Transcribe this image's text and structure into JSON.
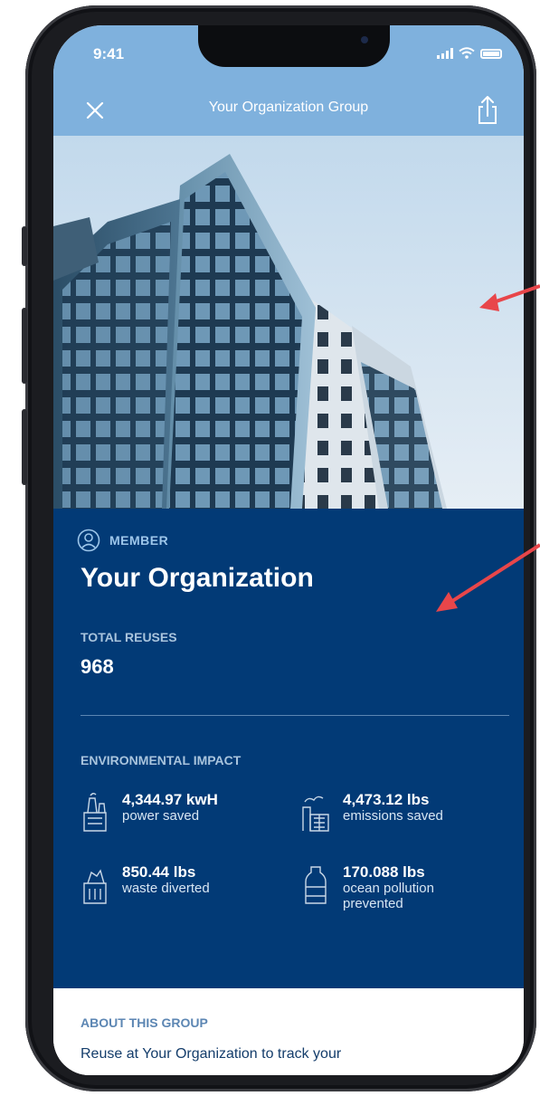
{
  "status_bar": {
    "time": "9:41"
  },
  "header": {
    "title": "Your Organization Group",
    "close_icon": "close-icon",
    "share_icon": "share-icon"
  },
  "hero": {
    "image": "building-photo"
  },
  "organization": {
    "role_label": "MEMBER",
    "role_icon": "user-circle-icon",
    "name": "Your Organization",
    "total_reuses_label": "TOTAL REUSES",
    "total_reuses_value": "968"
  },
  "environmental_impact": {
    "label": "ENVIRONMENTAL IMPACT",
    "stats": [
      {
        "value": "4,344.97 kwH",
        "desc": "power saved",
        "icon": "power-plant-icon"
      },
      {
        "value": "4,473.12 lbs",
        "desc": "emissions saved",
        "icon": "factory-icon"
      },
      {
        "value": "850.44 lbs",
        "desc": "waste diverted",
        "icon": "waste-bin-icon"
      },
      {
        "value": "170.088 lbs",
        "desc_line1": "ocean pollution",
        "desc_line2": "prevented",
        "icon": "bottle-icon"
      }
    ]
  },
  "about": {
    "title": "ABOUT THIS GROUP",
    "text": "Reuse at Your Organization to track your"
  },
  "colors": {
    "header_blue": "#7fb1dd",
    "panel_navy": "#023a76",
    "annotation_red": "#e8464a"
  }
}
